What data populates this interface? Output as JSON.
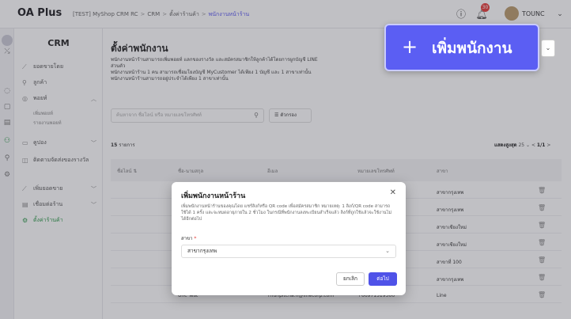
{
  "app": {
    "logo": "OA Plus",
    "breadcrumb": [
      "[TEST] MyShop CRM RC",
      "CRM",
      "ตั้งค่าร้านค้า",
      "พนักงานหน้าร้าน"
    ],
    "user_name": "TOUNC",
    "notification_count": "30"
  },
  "sidebar": {
    "title": "CRM",
    "items": [
      {
        "label": "ยอดขายโดย",
        "icon": "chart-icon"
      },
      {
        "label": "ลูกค้า",
        "icon": "user-icon"
      },
      {
        "label": "พอยท์",
        "icon": "points-icon"
      },
      {
        "label": "คูปอง",
        "icon": "coupon-icon"
      },
      {
        "label": "ติดตามจัดส่งของรางวัล",
        "icon": "tracking-icon"
      },
      {
        "label": "เพิ่มยอดขาย",
        "icon": "growth-icon"
      },
      {
        "label": "เชื่อมต่อร้าน",
        "icon": "store-icon"
      },
      {
        "label": "ตั้งค่าร้านค้า",
        "icon": "settings-icon"
      }
    ],
    "sub_items": [
      "เพิ่มพอยท์",
      "รายงานพอยท์"
    ]
  },
  "main": {
    "title": "ตั้งค่าพนักงาน",
    "desc_lines": [
      "พนักงานหน้าร้านสามารถเพิ่มพอยท์ แลกของรางวัล และสมัครสมาชิกให้ลูกค้าได้โดยการผูกบัญชี LINE",
      "ส่วนตัว",
      "พนักงานหน้าร้าน 1 คน สามารถเชื่อมโยงบัญชี MyCustomer ได้เพียง 1 บัญชี และ 1 สาขาเท่านั้น",
      "พนักงานหน้าร้านสามารถอยู่ประจำได้เพียง 1 สาขาเท่านั้น"
    ],
    "search_placeholder": "ค้นหาจาก ชื่อโลน์ หรือ หมายเลขโทรศัพท์",
    "filter_label": "ตัวกรอง",
    "count_number": "15",
    "count_unit": "รายการ",
    "pager_label": "แสดงสูงสุด",
    "page_size": "25",
    "page_info": "1/1"
  },
  "table": {
    "headers": [
      "ชื่อไลน์ ⇅",
      "ชื่อ-นามสกุล",
      "อีเมล",
      "หมายเลขโทรศัพท์",
      "สาขา"
    ],
    "rows": [
      [
        "",
        "",
        "",
        "",
        "สาขากรุงเทพ"
      ],
      [
        "",
        "",
        "",
        "",
        "สาขากรุงเทพ"
      ],
      [
        "",
        "",
        "",
        "",
        "สาขาเชียงใหม่"
      ],
      [
        "",
        "",
        "",
        "",
        "สาขาเชียงใหม่"
      ],
      [
        "",
        "",
        "",
        "",
        "สาขาที่ 100"
      ],
      [
        "",
        "",
        "",
        "",
        "สาขากรุงเทพ"
      ],
      [
        "",
        "Unc Test",
        "Thunpitcha.h@linecorp.com",
        "+66971519366",
        "Line"
      ]
    ]
  },
  "callout": {
    "plus": "+",
    "label": "เพิ่มพนักงาน"
  },
  "modal": {
    "title": "เพิ่มพนักงานหน้าร้าน",
    "desc": "เพิ่มพนักงานหน้าร้านของคุณโดย แชร์ลิงก์หรือ QR code เพื่อสมัครสมาชิก หมายเหตุ: 1 ลิงก์/QR code สามารถใช้ได้ 1 ครั้ง และจะหมดอายุภายใน 2 ชั่วโมง ในกรณีที่พนักงานลงทะเบียนสำเร็จแล้ว ลิงก์ที่ถูกใช้แล้วจะใช้งานไม่ได้อีกต่อไป",
    "branch_label": "สาขา",
    "branch_value": "สาขากรุงเทพ",
    "cancel_label": "ยกเลิก",
    "next_label": "ต่อไป"
  },
  "colors": {
    "accent": "#5b5ef3",
    "primary_button": "#4f52e8",
    "active_green": "#2e9a4a"
  }
}
